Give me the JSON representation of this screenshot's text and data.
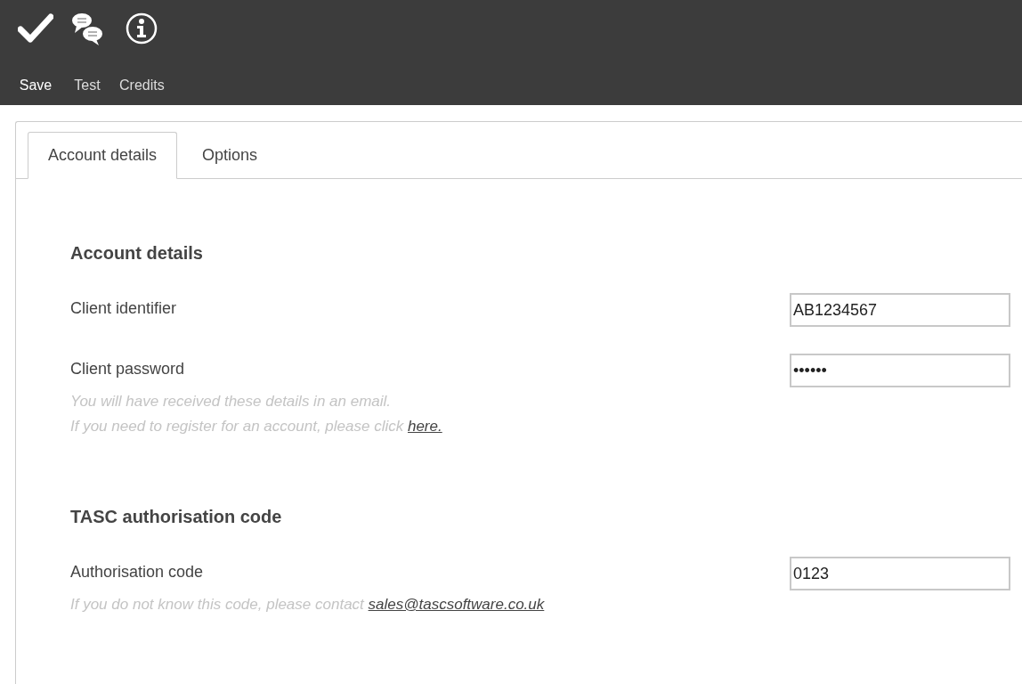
{
  "toolbar": [
    {
      "kind": "check",
      "label": "Save"
    },
    {
      "kind": "chat",
      "label": "Test"
    },
    {
      "kind": "info",
      "label": "Credits"
    }
  ],
  "tabs": [
    {
      "label": "Account details",
      "selected": true
    },
    {
      "label": "Options",
      "selected": false
    }
  ],
  "sections": [
    {
      "heading": "Account details",
      "fields": [
        {
          "label": "Client identifier",
          "value": "AB1234567"
        },
        {
          "label": "Client password",
          "value": "••••••"
        }
      ],
      "hint": {
        "lines": [
          "You will have received these details in an email.",
          "If you need to register for an account, please click"
        ],
        "link": "here."
      }
    },
    {
      "heading": "TASC authorisation code",
      "fields": [
        {
          "label": "Authorisation code",
          "value": "0123"
        }
      ],
      "hint": {
        "lines": [
          "If you do not know this code, please contact"
        ],
        "link": "sales@tascsoftware.co.uk"
      }
    }
  ]
}
